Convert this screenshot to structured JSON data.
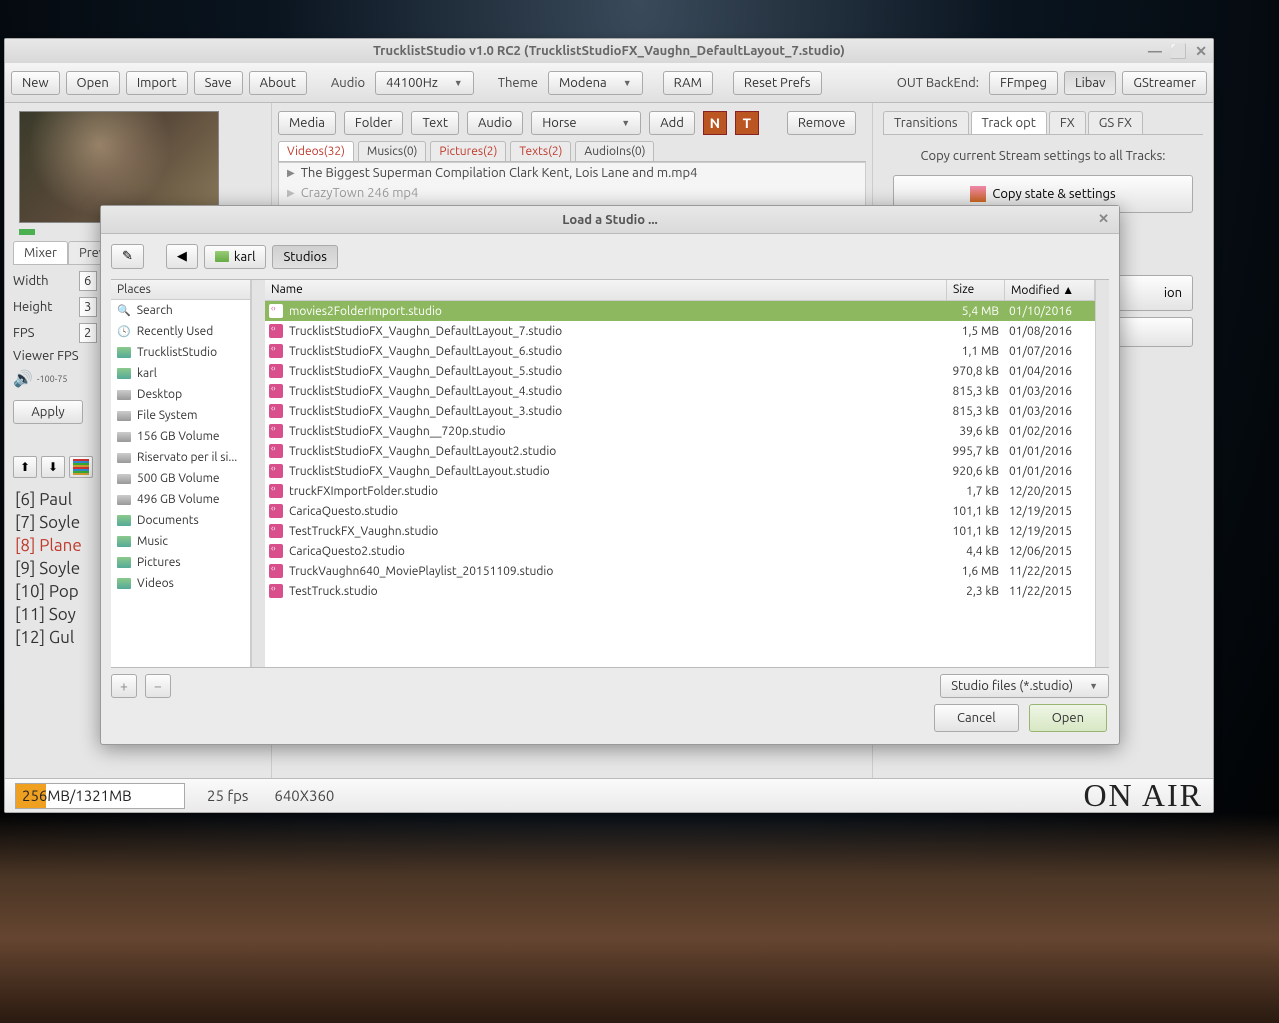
{
  "window": {
    "title": "TrucklistStudio v1.0 RC2 (TrucklistStudioFX_Vaughn_DefaultLayout_7.studio)",
    "minimize": "—",
    "maximize": "⬜",
    "close": "✕"
  },
  "toolbar": {
    "new": "New",
    "open": "Open",
    "import": "Import",
    "save": "Save",
    "about": "About",
    "audio_label": "Audio",
    "audio_value": "44100Hz",
    "theme_label": "Theme",
    "theme_value": "Modena",
    "ram": "RAM",
    "reset": "Reset Prefs",
    "backend_label": "OUT BackEnd:",
    "ffmpeg": "FFmpeg",
    "libav": "Libav",
    "gstreamer": "GStreamer"
  },
  "mid_toolbar": {
    "media": "Media",
    "folder": "Folder",
    "text": "Text",
    "audio": "Audio",
    "horse": "Horse",
    "add": "Add",
    "remove": "Remove",
    "icon_a": "N",
    "icon_b": "T"
  },
  "mid_tabs": {
    "videos": "Videos(32)",
    "musics": "Musics(0)",
    "pictures": "Pictures(2)",
    "texts": "Texts(2)",
    "audioins": "AudioIns(0)"
  },
  "mid_list": {
    "row0": "The Biggest Superman Compilation Clark Kent, Lois Lane and m.mp4",
    "row1": "CrazyTown 246 mp4"
  },
  "left_tabs": {
    "mixer": "Mixer",
    "prev": "Prev"
  },
  "form": {
    "width_label": "Width",
    "width_val": "6",
    "height_label": "Height",
    "height_val": "3",
    "fps_label": "FPS",
    "fps_val": "2",
    "viewer_label": "Viewer FPS",
    "apply": "Apply",
    "slider_ticks": "-100-75"
  },
  "right": {
    "tabs": {
      "transitions": "Transitions",
      "trackopt": "Track opt",
      "fx": "FX",
      "gsfx": "GS FX"
    },
    "msg": "Copy current Stream settings to all Tracks:",
    "copybtn": "Copy state & settings",
    "hidden_btn": "ion"
  },
  "playlist": {
    "items": [
      {
        "text": "[6] Paul",
        "red": false
      },
      {
        "text": "[7] Soyle",
        "red": false
      },
      {
        "text": "[8] Plane",
        "red": true
      },
      {
        "text": "[9] Soyle",
        "red": false
      },
      {
        "text": "[10] Pop",
        "red": false
      },
      {
        "text": "[11] Soy",
        "red": false
      },
      {
        "text": "[12] Gul",
        "red": false
      }
    ]
  },
  "status": {
    "mem": "256MB/1321MB",
    "fps": "25 fps",
    "res": "640X360",
    "onair": "ON AIR"
  },
  "dialog": {
    "title": "Load a Studio ...",
    "pencil": "✎",
    "back": "◀",
    "path_karl": "karl",
    "path_studios": "Studios",
    "places_hdr": "Places",
    "places": [
      {
        "name": "Search",
        "icon": "mag"
      },
      {
        "name": "Recently Used",
        "icon": "clock"
      },
      {
        "name": "TrucklistStudio",
        "icon": "folder"
      },
      {
        "name": "karl",
        "icon": "folder"
      },
      {
        "name": "Desktop",
        "icon": "drive"
      },
      {
        "name": "File System",
        "icon": "drive"
      },
      {
        "name": "156 GB Volume",
        "icon": "drive"
      },
      {
        "name": "Riservato per il si...",
        "icon": "drive"
      },
      {
        "name": "500 GB Volume",
        "icon": "drive"
      },
      {
        "name": "496 GB Volume",
        "icon": "drive"
      },
      {
        "name": "Documents",
        "icon": "folder"
      },
      {
        "name": "Music",
        "icon": "folder"
      },
      {
        "name": "Pictures",
        "icon": "folder"
      },
      {
        "name": "Videos",
        "icon": "folder"
      }
    ],
    "col_name": "Name",
    "col_size": "Size",
    "col_mod": "Modified ▲",
    "files": [
      {
        "name": "movies2FolderImport.studio",
        "size": "5,4 MB",
        "mod": "01/10/2016",
        "sel": true
      },
      {
        "name": "TrucklistStudioFX_Vaughn_DefaultLayout_7.studio",
        "size": "1,5 MB",
        "mod": "01/08/2016"
      },
      {
        "name": "TrucklistStudioFX_Vaughn_DefaultLayout_6.studio",
        "size": "1,1 MB",
        "mod": "01/07/2016"
      },
      {
        "name": "TrucklistStudioFX_Vaughn_DefaultLayout_5.studio",
        "size": "970,8 kB",
        "mod": "01/04/2016"
      },
      {
        "name": "TrucklistStudioFX_Vaughn_DefaultLayout_4.studio",
        "size": "815,3 kB",
        "mod": "01/03/2016"
      },
      {
        "name": "TrucklistStudioFX_Vaughn_DefaultLayout_3.studio",
        "size": "815,3 kB",
        "mod": "01/03/2016"
      },
      {
        "name": "TrucklistStudioFX_Vaughn__720p.studio",
        "size": "39,6 kB",
        "mod": "01/02/2016"
      },
      {
        "name": "TrucklistStudioFX_Vaughn_DefaultLayout2.studio",
        "size": "995,7 kB",
        "mod": "01/01/2016"
      },
      {
        "name": "TrucklistStudioFX_Vaughn_DefaultLayout.studio",
        "size": "920,6 kB",
        "mod": "01/01/2016"
      },
      {
        "name": "truckFXImportFolder.studio",
        "size": "1,7 kB",
        "mod": "12/20/2015"
      },
      {
        "name": "CaricaQuesto.studio",
        "size": "101,1 kB",
        "mod": "12/19/2015"
      },
      {
        "name": "TestTruckFX_Vaughn.studio",
        "size": "101,1 kB",
        "mod": "12/19/2015"
      },
      {
        "name": "CaricaQuesto2.studio",
        "size": "4,4 kB",
        "mod": "12/06/2015"
      },
      {
        "name": "TruckVaughn640_MoviePlaylist_20151109.studio",
        "size": "1,6 MB",
        "mod": "11/22/2015"
      },
      {
        "name": "TestTruck.studio",
        "size": "2,3 kB",
        "mod": "11/22/2015"
      }
    ],
    "add_place": "+",
    "remove_place": "−",
    "filter": "Studio files (*.studio)",
    "cancel": "Cancel",
    "open": "Open"
  }
}
